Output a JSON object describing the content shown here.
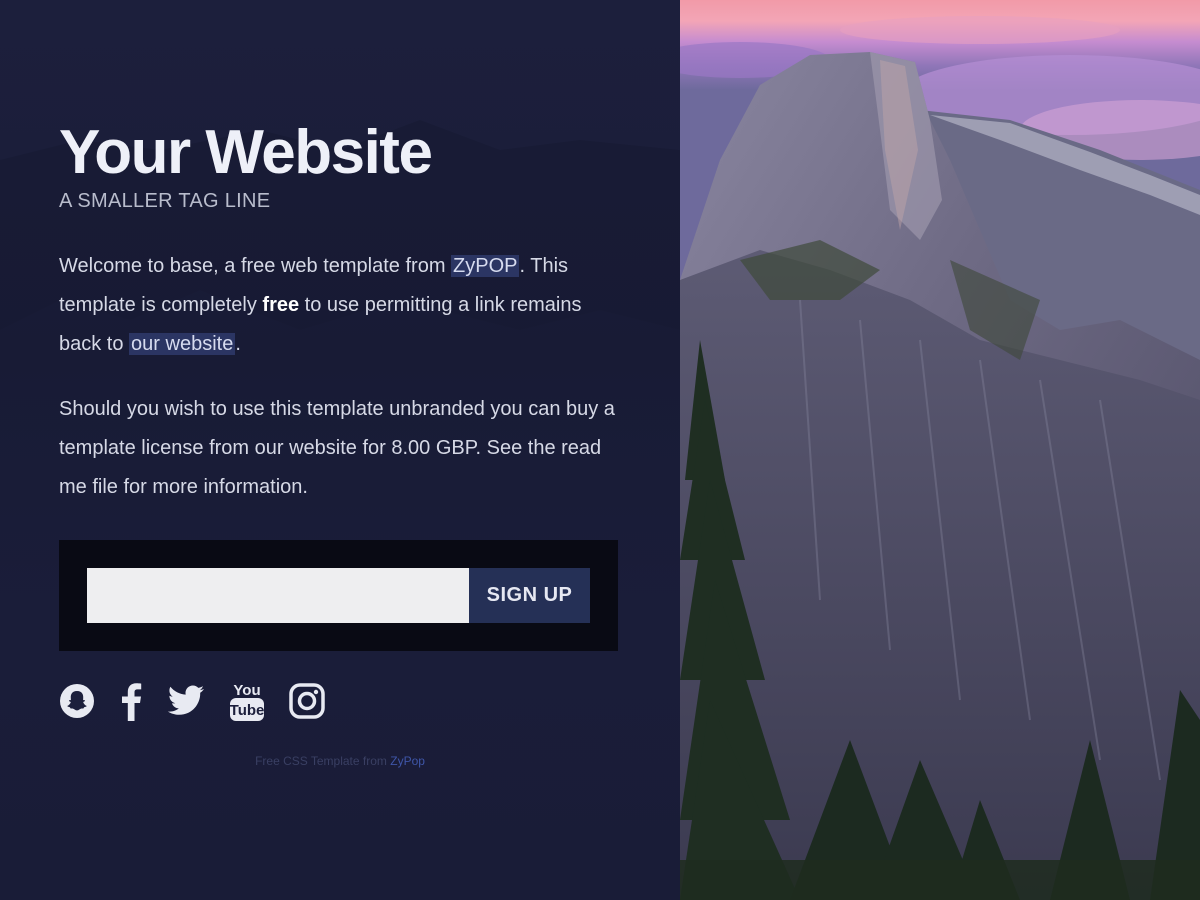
{
  "header": {
    "title": "Your Website",
    "tagline": "A SMALLER TAG LINE"
  },
  "intro": {
    "p1_before": "Welcome to base, a free web template from ",
    "p1_link1": "ZyPOP",
    "p1_mid1": ". This template is completely ",
    "p1_bold": "free",
    "p1_mid2": " to use permitting a link remains back to ",
    "p1_link2": "our website",
    "p1_after": ".",
    "p2": "Should you wish to use this template unbranded you can buy a template license from our website for 8.00 GBP. See the read me file for more information."
  },
  "signup": {
    "email_value": "",
    "email_placeholder": "",
    "button_label": "SIGN UP"
  },
  "social": {
    "icons": [
      "snapchat-icon",
      "facebook-icon",
      "twitter-icon",
      "youtube-icon",
      "instagram-icon"
    ],
    "youtube_top": "You",
    "youtube_bottom": "Tube"
  },
  "footer": {
    "credit_text": "Free CSS Template from ",
    "credit_link": "ZyPop"
  },
  "colors": {
    "panel_bg": "#1c1f3c",
    "link_highlight": "#2b3563",
    "button_bg": "#253056",
    "signup_box_bg": "#090a14",
    "footer_link": "#3f55a8"
  }
}
